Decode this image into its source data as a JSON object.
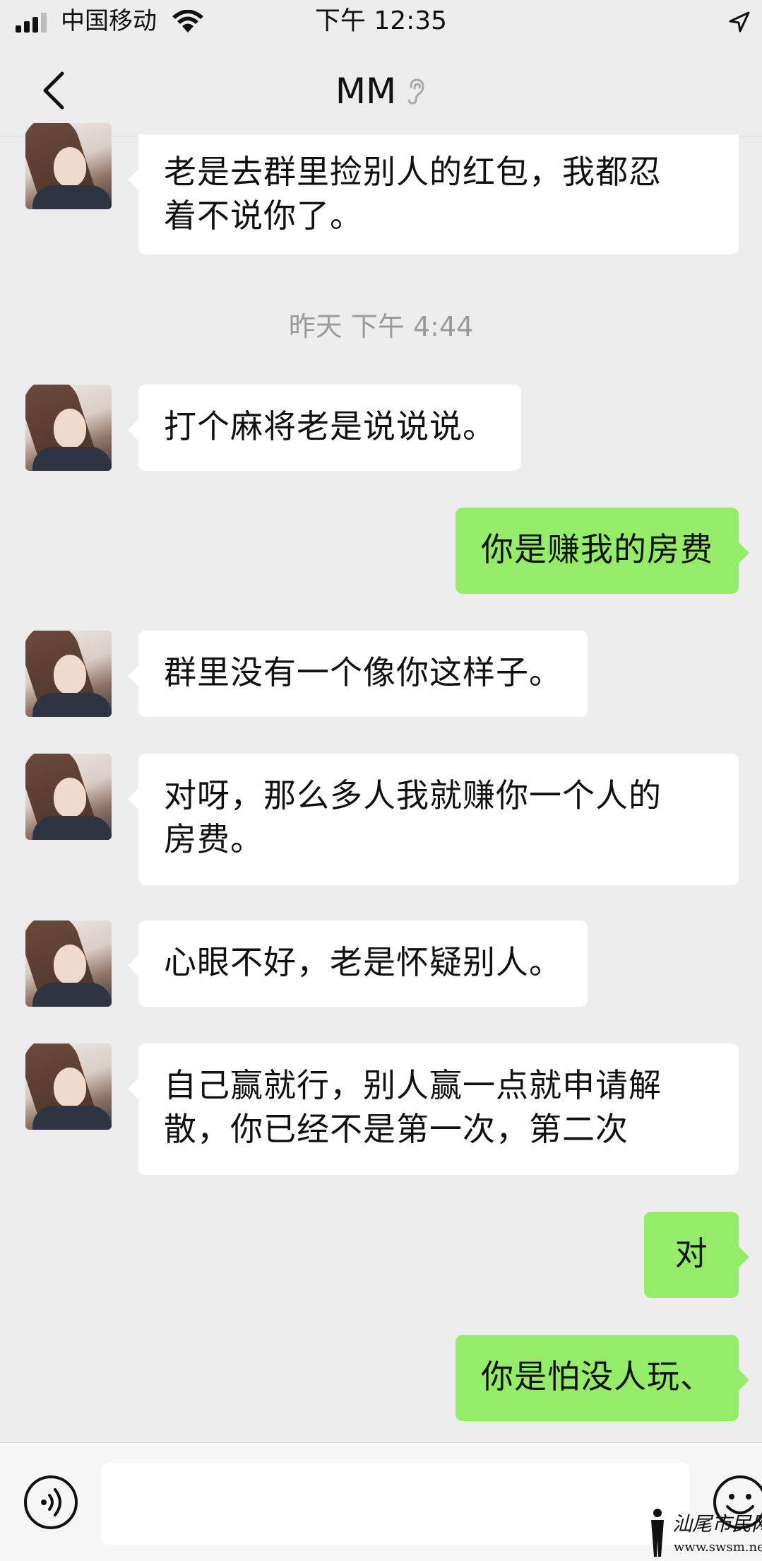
{
  "status_bar": {
    "carrier": "中国移动",
    "time": "下午 12:35"
  },
  "nav": {
    "title": "MM"
  },
  "messages": [
    {
      "side": "in",
      "text": "老是去群里捡别人的红包，我都忍\n着不说你了。"
    },
    {
      "side": "in",
      "text": "打个麻将老是说说说。"
    },
    {
      "side": "out",
      "text": "你是赚我的房费"
    },
    {
      "side": "in",
      "text": "群里没有一个像你这样子。"
    },
    {
      "side": "in",
      "text": "对呀，那么多人我就赚你一个人的\n房费。"
    },
    {
      "side": "in",
      "text": "心眼不好，老是怀疑别人。"
    },
    {
      "side": "in",
      "text": "自己赢就行，别人赢一点就申请解\n散，你已经不是第一次，第二次"
    },
    {
      "side": "out",
      "text": "对"
    },
    {
      "side": "out",
      "text": "你是怕没人玩、"
    }
  ],
  "timestamp": "昨天 下午 4:44",
  "input": {
    "value": ""
  },
  "watermark": {
    "text": "汕尾市民网",
    "url": "www.swsm.net"
  },
  "colors": {
    "outgoing_bubble": "#95ec69",
    "incoming_bubble": "#ffffff",
    "background": "#ededed"
  },
  "icons": [
    "back-chevron-icon",
    "earpiece-icon",
    "voice-icon",
    "emoji-icon",
    "wifi-icon",
    "location-arrow-icon",
    "signal-bars-icon"
  ]
}
